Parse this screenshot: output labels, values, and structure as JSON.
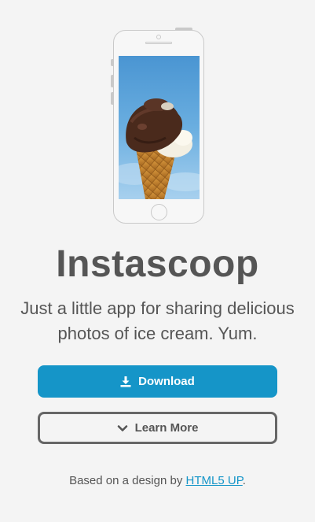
{
  "app": {
    "title": "Instascoop",
    "tagline": "Just a little app for sharing delicious photos of ice cream. Yum."
  },
  "actions": {
    "download_label": "Download",
    "download_icon": "download-icon",
    "learn_more_label": "Learn More",
    "learn_more_icon": "chevron-down-icon"
  },
  "footer": {
    "prefix": "Based on a design by ",
    "link_label": "HTML5 UP",
    "suffix": "."
  },
  "colors": {
    "background": "#f4f4f4",
    "accent": "#1595c8",
    "text": "#555555",
    "outline_button_border": "#666666"
  }
}
